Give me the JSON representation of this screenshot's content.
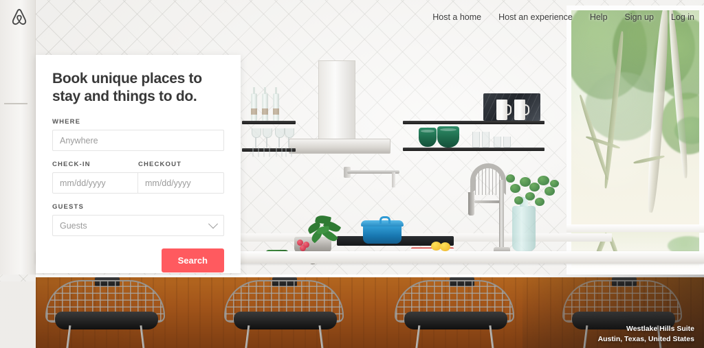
{
  "nav": {
    "logo_icon": "airbnb-belo-logo",
    "links": [
      {
        "label": "Host a home"
      },
      {
        "label": "Host an experience"
      },
      {
        "label": "Help"
      },
      {
        "label": "Sign up"
      },
      {
        "label": "Log in"
      }
    ]
  },
  "search_card": {
    "heading": "Book unique places to stay and things to do.",
    "where": {
      "label": "WHERE",
      "placeholder": "Anywhere",
      "value": ""
    },
    "checkin": {
      "label": "CHECK-IN",
      "placeholder": "mm/dd/yyyy",
      "value": ""
    },
    "checkout": {
      "label": "CHECKOUT",
      "placeholder": "mm/dd/yyyy",
      "value": ""
    },
    "guests": {
      "label": "GUESTS",
      "selected": "Guests",
      "chevron_icon": "chevron-down-icon"
    },
    "search_button": {
      "label": "Search",
      "color": "#ff5a5f"
    }
  },
  "photo_caption": {
    "title": "Westlake Hills Suite",
    "location": "Austin, Texas, United States"
  },
  "colors": {
    "brand_coral": "#ff5a5f",
    "heading_text": "#383838",
    "label_text": "#565656",
    "placeholder_text": "#9b9b9b",
    "card_background": "#ffffff",
    "wood_island": "#a2551a"
  }
}
